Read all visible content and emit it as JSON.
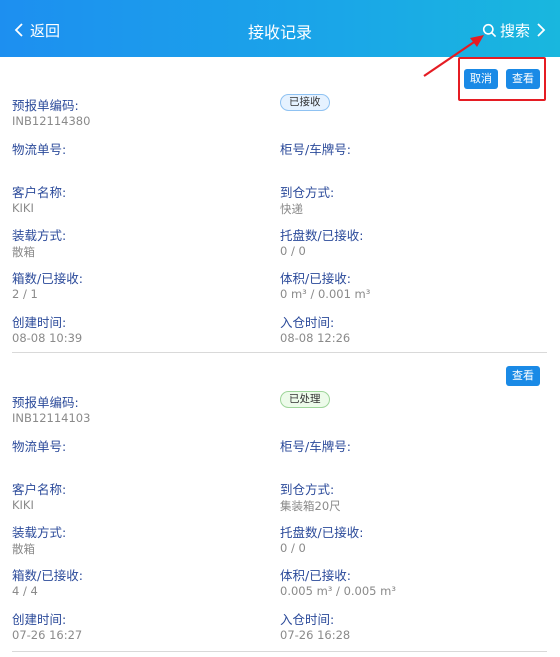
{
  "header": {
    "back_label": "返回",
    "title": "接收记录",
    "search_label": "搜索"
  },
  "colors": {
    "header_gradient": [
      "#1d8ff0",
      "#19b7de"
    ],
    "button": "#1a8ae6",
    "label_text": "#2b4a9a",
    "value_text": "#8a8a8a",
    "annotation": "#e51c23"
  },
  "records": [
    {
      "actions": {
        "cancel_label": "取消",
        "view_label": "查看"
      },
      "status": "已接收",
      "prebook_no_label": "预报单编码:",
      "prebook_no": "INB12114380",
      "logistics_no_label": "物流单号:",
      "logistics_no": "",
      "container_label": "柜号/车牌号:",
      "container": "",
      "customer_label": "客户名称:",
      "customer": "KIKI",
      "arrival_method_label": "到仓方式:",
      "arrival_method": "快递",
      "loading_method_label": "装载方式:",
      "loading_method": "散箱",
      "pallets_label": "托盘数/已接收:",
      "pallets": "0 / 0",
      "boxes_label": "箱数/已接收:",
      "boxes": "2 / 1",
      "volume_label": "体积/已接收:",
      "volume": "0 m³ / 0.001 m³",
      "created_label": "创建时间:",
      "created": "08-08 10:39",
      "inbound_label": "入仓时间:",
      "inbound": "08-08 12:26"
    },
    {
      "actions": {
        "view_label": "查看"
      },
      "status": "已处理",
      "prebook_no_label": "预报单编码:",
      "prebook_no": "INB12114103",
      "logistics_no_label": "物流单号:",
      "logistics_no": "",
      "container_label": "柜号/车牌号:",
      "container": "",
      "customer_label": "客户名称:",
      "customer": "KIKI",
      "arrival_method_label": "到仓方式:",
      "arrival_method": "集装箱20尺",
      "loading_method_label": "装载方式:",
      "loading_method": "散箱",
      "pallets_label": "托盘数/已接收:",
      "pallets": "0 / 0",
      "boxes_label": "箱数/已接收:",
      "boxes": "4 / 4",
      "volume_label": "体积/已接收:",
      "volume": "0.005 m³ / 0.005 m³",
      "created_label": "创建时间:",
      "created": "07-26 16:27",
      "inbound_label": "入仓时间:",
      "inbound": "07-26 16:28"
    }
  ]
}
